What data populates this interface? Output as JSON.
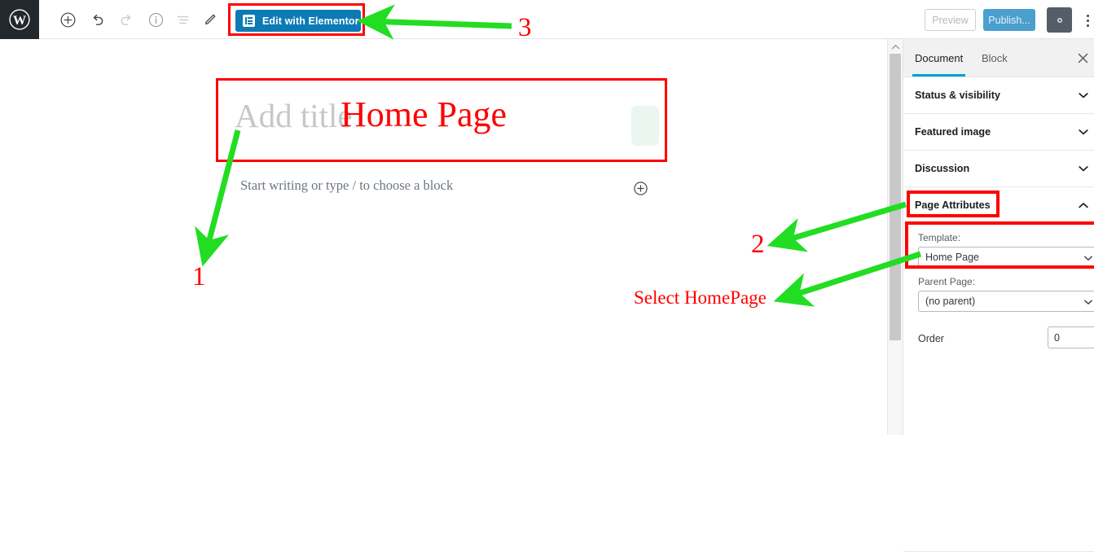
{
  "app": {
    "name": "WordPress Block Editor",
    "logo_icon": "wordpress-logo-icon"
  },
  "toolbar": {
    "icons": [
      {
        "name": "add-block-icon",
        "glyph": "plus-circle"
      },
      {
        "name": "undo-icon",
        "glyph": "undo-arrow"
      },
      {
        "name": "redo-icon",
        "glyph": "redo-arrow"
      },
      {
        "name": "details-info-icon",
        "glyph": "info-circle"
      },
      {
        "name": "block-navigation-icon",
        "glyph": "list-view"
      },
      {
        "name": "edit-pencil-icon",
        "glyph": "pencil"
      }
    ],
    "elementor_button_label": "Edit with Elementor",
    "elementor_button_icon": "elementor-document-icon",
    "elementor_button_color": "#0c7ab5",
    "preview_label": "Preview",
    "publish_label": "Publish...",
    "publish_color": "#4a9fce",
    "settings_icon": "gear-icon",
    "more_menu_icon": "vertical-ellipsis-icon"
  },
  "editor": {
    "title_placeholder": "Add title",
    "paragraph_placeholder": "Start writing or type / to choose a block",
    "add_block_icon": "plus-circle-icon"
  },
  "sidebar": {
    "tabs": [
      {
        "label": "Document",
        "active": true
      },
      {
        "label": "Block",
        "active": false
      }
    ],
    "close_icon": "close-x-icon",
    "panels": [
      {
        "label": "Status & visibility",
        "expanded": false,
        "chevron": "chevron-down-icon"
      },
      {
        "label": "Featured image",
        "expanded": false,
        "chevron": "chevron-down-icon"
      },
      {
        "label": "Discussion",
        "expanded": false,
        "chevron": "chevron-down-icon"
      },
      {
        "label": "Page Attributes",
        "expanded": true,
        "chevron": "chevron-up-icon"
      }
    ],
    "page_attributes": {
      "template_label": "Template:",
      "template_value": "Home Page",
      "parent_label": "Parent Page:",
      "parent_value": "(no parent)",
      "order_label": "Order",
      "order_value": "0"
    },
    "scrollbar": {
      "up_arrow_icon": "scroll-up-arrow-icon"
    }
  },
  "annotations": {
    "color": "#fe0000",
    "arrow_color": "#22dd22",
    "title_note": "Home Page",
    "marker_1": "1",
    "marker_2": "2",
    "marker_3": "3",
    "select_note": "Select HomePage"
  },
  "highlights": {
    "elementor_button": "#fe0000",
    "title_field": "#fe0000",
    "page_attributes_panel": "#fe0000",
    "template_field": "#fe0000"
  }
}
